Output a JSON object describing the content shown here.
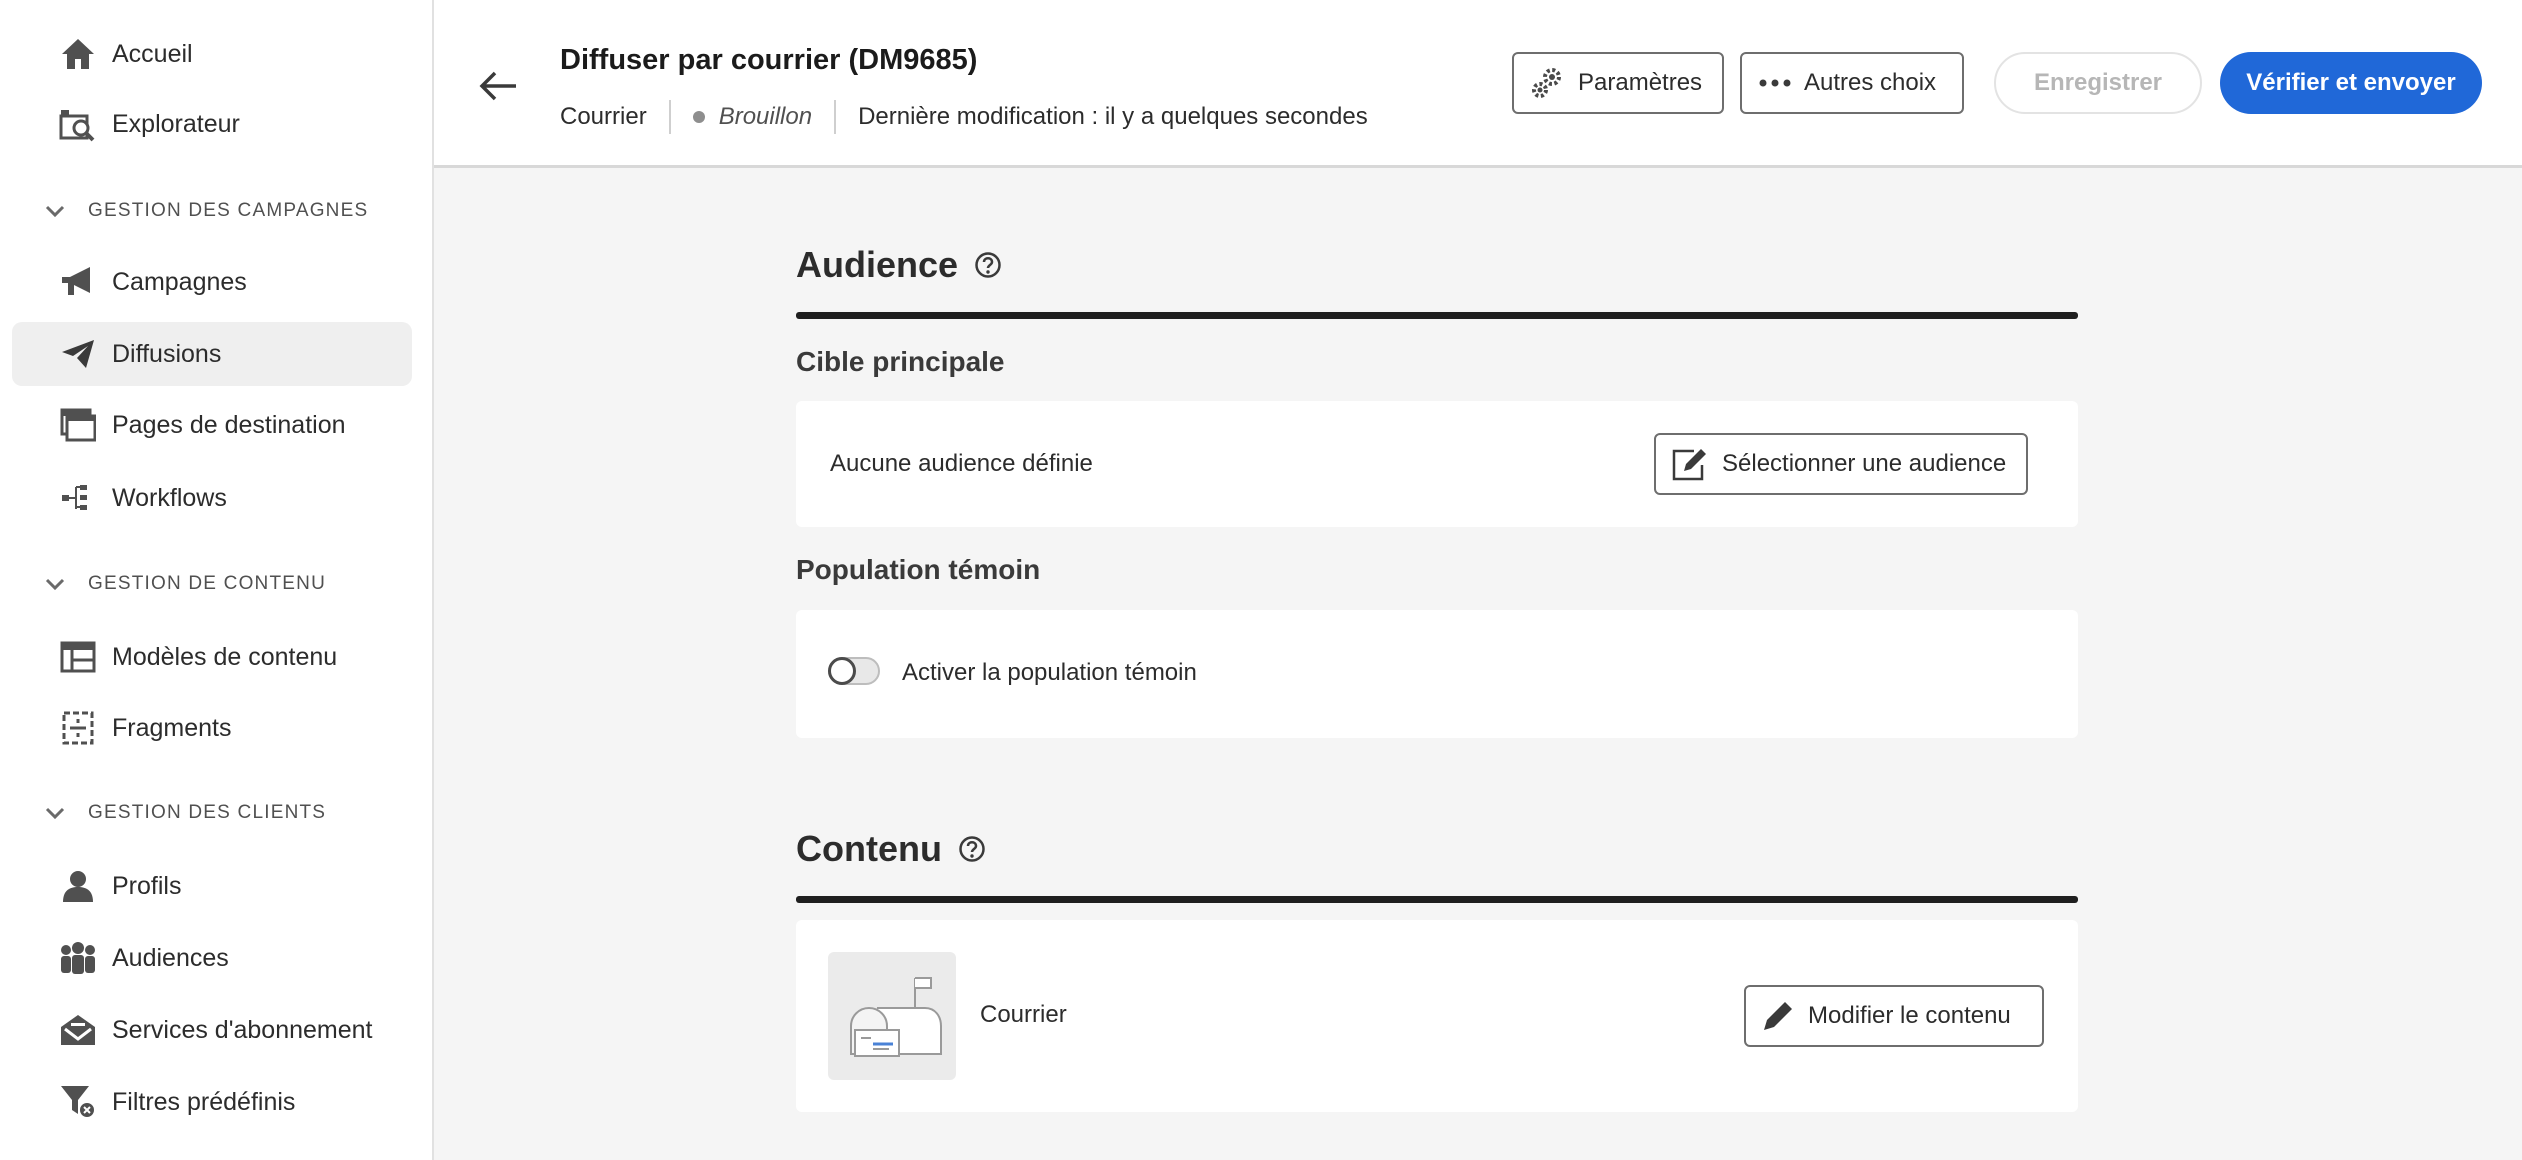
{
  "sidebar": {
    "items": [
      {
        "label": "Accueil",
        "icon": "home-icon"
      },
      {
        "label": "Explorateur",
        "icon": "explorer-icon"
      },
      {
        "label": "Campagnes",
        "icon": "megaphone-icon"
      },
      {
        "label": "Diffusions",
        "icon": "send-icon",
        "selected": true
      },
      {
        "label": "Pages de destination",
        "icon": "landing-page-icon"
      },
      {
        "label": "Workflows",
        "icon": "workflow-icon"
      },
      {
        "label": "Modèles de contenu",
        "icon": "template-icon"
      },
      {
        "label": "Fragments",
        "icon": "fragment-icon"
      },
      {
        "label": "Profils",
        "icon": "profile-icon"
      },
      {
        "label": "Audiences",
        "icon": "audiences-icon"
      },
      {
        "label": "Services d'abonnement",
        "icon": "subscription-icon"
      },
      {
        "label": "Filtres prédéfinis",
        "icon": "filter-icon"
      }
    ],
    "sections": [
      {
        "label": "GESTION DES CAMPAGNES"
      },
      {
        "label": "GESTION DE CONTENU"
      },
      {
        "label": "GESTION DES CLIENTS"
      }
    ]
  },
  "header": {
    "title": "Diffuser par courrier (DM9685)",
    "channel": "Courrier",
    "status": "Brouillon",
    "last_modified": "Dernière modification : il y a quelques secondes",
    "buttons": {
      "settings": "Paramètres",
      "more": "Autres choix",
      "save": "Enregistrer",
      "review": "Vérifier et envoyer"
    }
  },
  "audience": {
    "title": "Audience",
    "main_target_title": "Cible principale",
    "no_audience": "Aucune audience définie",
    "select_button": "Sélectionner une audience",
    "control_title": "Population témoin",
    "control_toggle_label": "Activer la population témoin",
    "control_enabled": false
  },
  "content": {
    "title": "Contenu",
    "item_label": "Courrier",
    "edit_button": "Modifier le contenu"
  },
  "colors": {
    "primary": "#2068d8",
    "rule": "#1f1f1f",
    "selected_bg": "#efefef"
  }
}
